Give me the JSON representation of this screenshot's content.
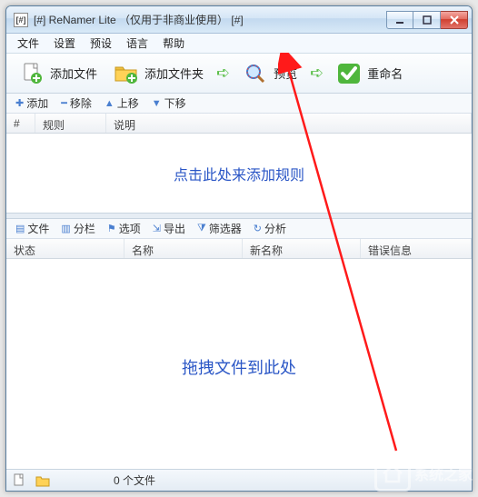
{
  "titlebar": {
    "icon_text": "[#]",
    "title": "[#] ReNamer Lite （仅用于非商业使用） [#]"
  },
  "menubar": {
    "file": "文件",
    "settings": "设置",
    "presets": "预设",
    "language": "语言",
    "help": "帮助"
  },
  "toolbar": {
    "add_file": "添加文件",
    "add_folder": "添加文件夹",
    "preview": "预览",
    "rename": "重命名"
  },
  "rulesbar": {
    "add": "添加",
    "remove": "移除",
    "up": "上移",
    "down": "下移"
  },
  "rules_header": {
    "num": "#",
    "rule": "规则",
    "desc": "说明"
  },
  "rules_hint": "点击此处来添加规则",
  "filesbar": {
    "files": "文件",
    "columns": "分栏",
    "options": "选项",
    "export": "导出",
    "filter": "筛选器",
    "analyze": "分析"
  },
  "files_header": {
    "status": "状态",
    "name": "名称",
    "newname": "新名称",
    "error": "错误信息"
  },
  "files_hint": "拖拽文件到此处",
  "status": {
    "count_text": "0 个文件"
  },
  "watermark": {
    "text": "系统之家"
  }
}
